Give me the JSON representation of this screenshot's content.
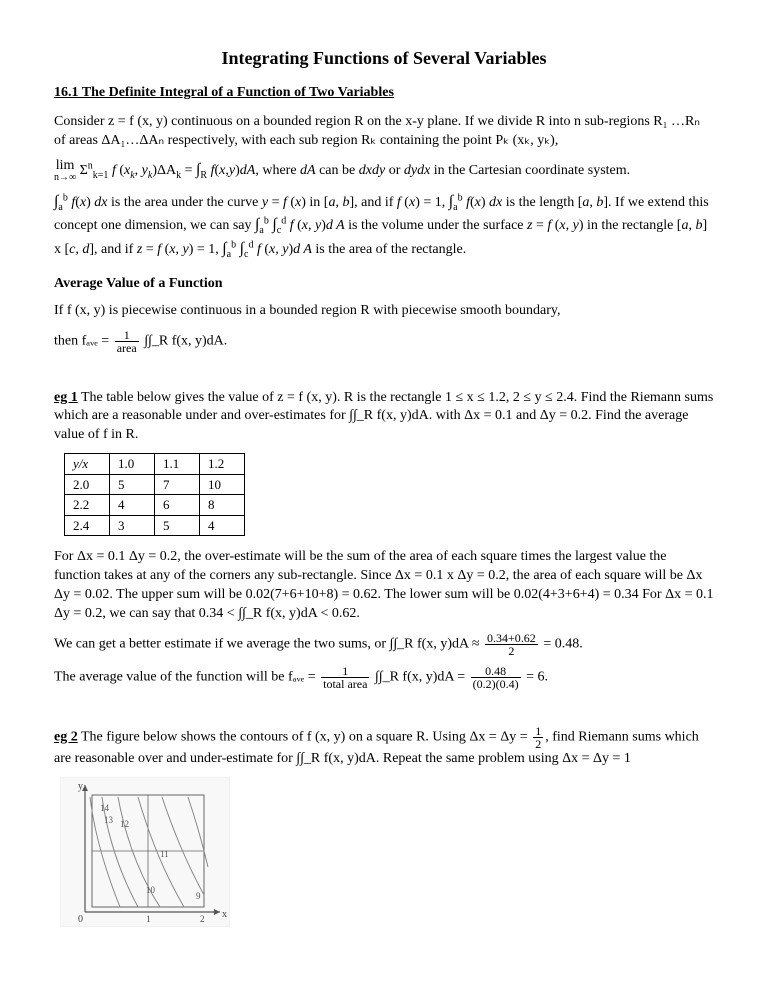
{
  "title": "Integrating Functions of Several Variables",
  "section_heading": "16.1  The Definite Integral of a Function of Two Variables",
  "intro_p1": "Consider z = f (x, y) continuous on a bounded region R on the x-y plane.  If we divide R into n sub-regions R₁ …Rₙ of areas ΔA₁…ΔAₙ respectively, with each sub region Rₖ containing the point Pₖ (xₖ, yₖ),",
  "intro_p2": "lim (n→∞) Σₖ₌₁ⁿ f (xₖ, yₖ)ΔAₖ = ∫∫_R f(x,y)dA, where dA can be dxdy or dydx in the Cartesian coordinate system.",
  "intro_p3a": "∫ₐᵇ f(x) dx is the area under the curve y = f (x) in [a, b], and if f (x) = 1, ∫ₐᵇ f(x) dx is the length [a, b].  If we",
  "intro_p3b": "extend this concept one dimension, we can say ∫ₐᵇ ∫꜀ᵈ f (x, y)d A is the volume under the surface",
  "intro_p3c": "z = f (x, y) in the rectangle [a, b] x [c, d], and if z = f (x, y) = 1, ∫ₐᵇ ∫꜀ᵈ f (x, y)d A is the area of the rectangle.",
  "avg_heading": "Average Value of a Function",
  "avg_p1": "If f (x, y) is piecewise continuous in a bounded region R with piecewise smooth boundary,",
  "avg_p2_pre": " then fₐᵥₑ = ",
  "avg_p2_num": "1",
  "avg_p2_den": "area",
  "avg_p2_post": " ∫∫_R f(x, y)dA.",
  "eg1_label": "eg 1",
  "eg1_text": "  The table below gives the value of z = f (x, y). R is the rectangle 1 ≤ x ≤ 1.2, 2 ≤ y ≤ 2.4. Find the Riemann sums which are a reasonable under and over-estimates for ∫∫_R f(x, y)dA. with Δx = 0.1 and Δy = 0.2.  Find the average value of f in R.",
  "table": {
    "h": [
      "y/x",
      "1.0",
      "1.1",
      "1.2"
    ],
    "r1": [
      "2.0",
      "5",
      "7",
      "10"
    ],
    "r2": [
      "2.2",
      "4",
      "6",
      "8"
    ],
    "r3": [
      "2.4",
      "3",
      "5",
      "4"
    ]
  },
  "after_tbl_p1": "For Δx = 0.1 Δy = 0.2, the over-estimate will be the sum of the area of each square times the largest value the function takes at any of the corners any sub-rectangle.  Since Δx = 0.1 x Δy = 0.2, the area of each square will be Δx Δy = 0.02.  The upper sum will be 0.02(7+6+10+8) = 0.62. The lower sum will be 0.02(4+3+6+4) = 0.34 For Δx = 0.1 Δy = 0.2, we can say that 0.34 < ∫∫_R f(x, y)dA < 0.62.",
  "after_tbl_p2_a": "We can get a better estimate if we average the two sums, or ∫∫_R f(x, y)dA ≈ ",
  "after_tbl_p2_num1": "0.34+0.62",
  "after_tbl_p2_den1": "2",
  "after_tbl_p2_b": " = 0.48.",
  "after_tbl_p3_a": "The average value of the function will be fₐᵥₑ = ",
  "after_tbl_p3_num1": "1",
  "after_tbl_p3_den1": "total area",
  "after_tbl_p3_b": " ∫∫_R f(x, y)dA = ",
  "after_tbl_p3_num2": "0.48",
  "after_tbl_p3_den2": "(0.2)(0.4)",
  "after_tbl_p3_c": " = 6.",
  "eg2_label": "eg 2",
  "eg2_text_a": "  The figure below shows the contours of f (x, y) on a square R.  Using Δx = Δy = ",
  "eg2_num": "1",
  "eg2_den": "2",
  "eg2_text_b": ", find Riemann sums which are reasonable over and under-estimate for ∫∫_R f(x, y)dA. Repeat the same problem using Δx = Δy = 1",
  "contour_labels": [
    "14",
    "13",
    "12",
    "11",
    "10",
    "9"
  ],
  "axis_labels": {
    "y": "y",
    "x": "x",
    "origin": "0",
    "one": "1",
    "two": "2"
  }
}
